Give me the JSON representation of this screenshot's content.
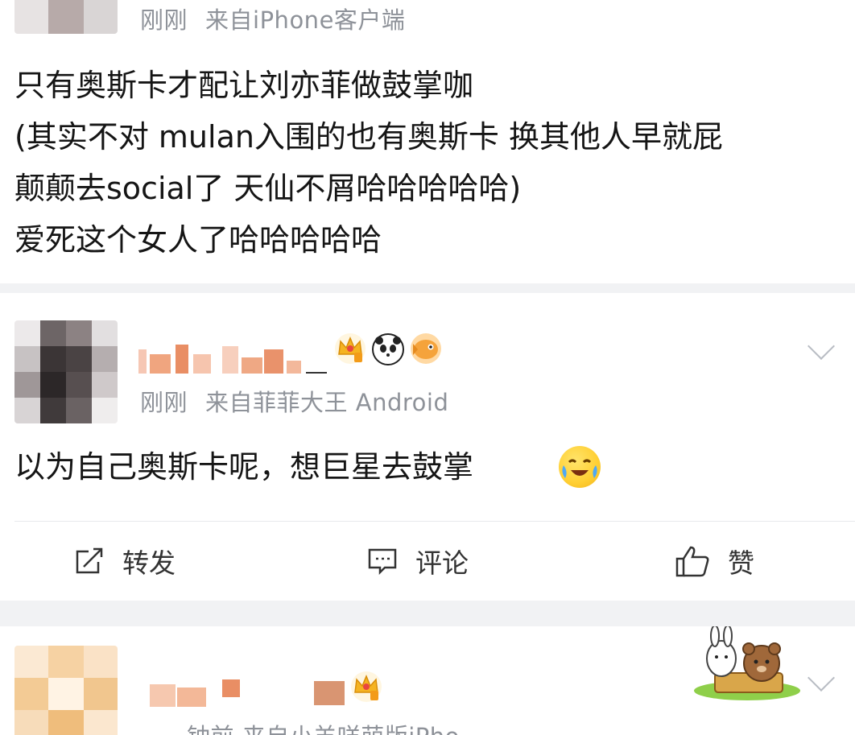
{
  "post1": {
    "meta_time": "刚刚",
    "meta_source": "来自iPhone客户端",
    "lines": [
      "只有奥斯卡才配让刘亦菲做鼓掌咖",
      "(其实不对 mulan入围的也有奥斯卡 换其他人早就屁",
      "颠颠去social了 天仙不屑哈哈哈哈哈)",
      "爱死这个女人了哈哈哈哈哈"
    ]
  },
  "post2": {
    "meta_time": "刚刚",
    "meta_source": "来自菲菲大王 Android",
    "text": "以为自己奥斯卡呢，想巨星去鼓掌",
    "badges": [
      "crown-badge",
      "panda-badge",
      "fish-badge"
    ],
    "actions": {
      "repost": "转发",
      "comment": "评论",
      "like": "赞"
    }
  },
  "post3": {
    "meta_partial": "钟前  来自小羊咩萌版iPho",
    "badges": [
      "crown-badge"
    ]
  },
  "colors": {
    "meta_gray": "#8e9299",
    "text_dark": "#151515",
    "separator": "#f1f2f4",
    "crown_gold": "#f5b321"
  }
}
